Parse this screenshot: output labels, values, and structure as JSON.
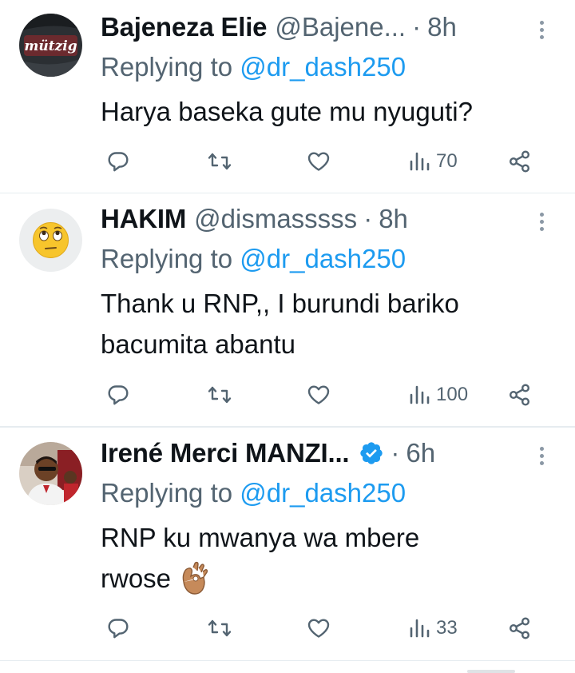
{
  "replies": [
    {
      "name": "Bajeneza Elie",
      "handle": "@Bajene...",
      "separator": "·",
      "time": "8h",
      "replying_prefix": "Replying to ",
      "replying_to": "@dr_dash250",
      "text_lines": [
        "Harya baseka gute mu nyuguti?"
      ],
      "avatar_text": "mützig",
      "views": "70"
    },
    {
      "name": "HAKIM",
      "handle": "@dismasssss",
      "separator": "·",
      "time": "8h",
      "replying_prefix": "Replying to ",
      "replying_to": "@dr_dash250",
      "text_lines": [
        "Thank u RNP,, I burundi bariko",
        "bacumita abantu"
      ],
      "views": "100"
    },
    {
      "name": "Irené Merci MANZI...",
      "handle": "",
      "separator": "·",
      "time": "6h",
      "replying_prefix": "Replying to ",
      "replying_to": "@dr_dash250",
      "text_lines": [
        "RNP ku mwanya wa mbere",
        "rwose"
      ],
      "views": "33"
    }
  ],
  "icons": {
    "reply": "comment-icon",
    "retweet": "retweet-icon",
    "like": "heart-icon",
    "views": "views-icon",
    "share": "share-icon",
    "more": "more-vertical-icon",
    "verified": "verified-badge-icon",
    "emoji": "ok-hand-emoji"
  },
  "colors": {
    "primary_text": "#0f1419",
    "secondary_text": "#536471",
    "mention": "#1d9bf0",
    "verified": "#1d9bf0",
    "divider": "#e6ecf0"
  }
}
